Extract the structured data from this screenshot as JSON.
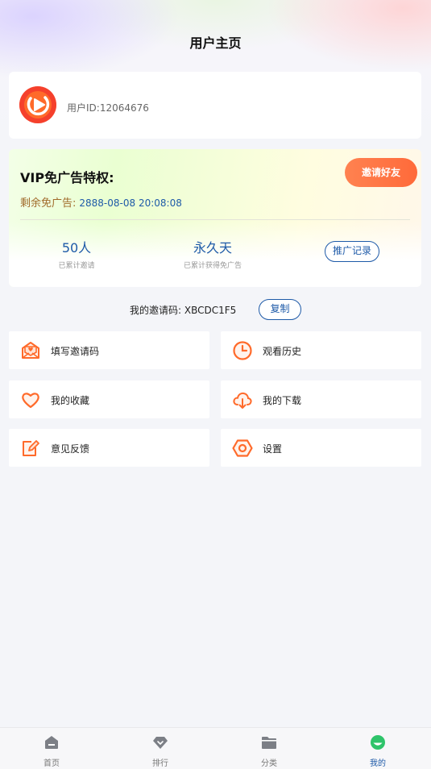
{
  "header": {
    "title": "用户主页"
  },
  "user": {
    "id_text": "用户ID:12064676",
    "avatar_icon": "play-logo-icon"
  },
  "vip": {
    "title": "VIP免广告特权:",
    "remain_label": "剩余免广告:",
    "remain_date": "2888-08-08 20:08:08",
    "invite_button": "邀请好友",
    "stats": [
      {
        "value": "50人",
        "caption": "已累计邀请"
      },
      {
        "value": "永久天",
        "caption": "已累计获得免广告"
      }
    ],
    "promo_button": "推广记录"
  },
  "invite": {
    "label": "我的邀请码:",
    "code": "XBCDC1F5",
    "copy_button": "复制"
  },
  "menu": [
    {
      "label": "填写邀请码",
      "icon": "envelope-heart-icon"
    },
    {
      "label": "观看历史",
      "icon": "clock-icon"
    },
    {
      "label": "我的收藏",
      "icon": "heart-icon"
    },
    {
      "label": "我的下载",
      "icon": "cloud-download-icon"
    },
    {
      "label": "意见反馈",
      "icon": "edit-icon"
    },
    {
      "label": "设置",
      "icon": "settings-hexagon-icon"
    }
  ],
  "tabbar": [
    {
      "label": "首页",
      "icon": "home-icon"
    },
    {
      "label": "排行",
      "icon": "diamond-icon"
    },
    {
      "label": "分类",
      "icon": "folder-icon"
    },
    {
      "label": "我的",
      "icon": "profile-icon",
      "active": true
    }
  ],
  "colors": {
    "accent": "#1e5aa8",
    "orange": "#ff6a3a",
    "background": "#f4f5f9"
  }
}
